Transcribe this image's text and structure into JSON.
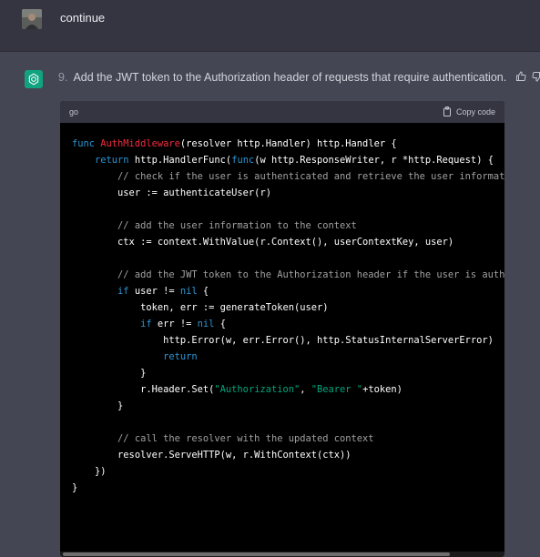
{
  "user_message": {
    "text": "continue"
  },
  "assistant_message": {
    "number": "9.",
    "text": "Add the JWT token to the Authorization header of requests that require authentication."
  },
  "code": {
    "language": "go",
    "copy_label": "Copy code",
    "lines": [
      [
        [
          "kw",
          "func "
        ],
        [
          "fn",
          "AuthMiddleware"
        ],
        [
          "",
          "(resolver http.Handler) http.Handler {"
        ]
      ],
      [
        [
          "",
          "    "
        ],
        [
          "kw",
          "return "
        ],
        [
          "",
          "http.HandlerFunc("
        ],
        [
          "kw",
          "func"
        ],
        [
          "",
          "(w http.ResponseWriter, r *http.Request) {"
        ]
      ],
      [
        [
          "",
          "        "
        ],
        [
          "cm",
          "// check if the user is authenticated and retrieve the user information"
        ]
      ],
      [
        [
          "",
          "        user := authenticateUser(r)"
        ]
      ],
      [
        [
          "",
          ""
        ]
      ],
      [
        [
          "",
          "        "
        ],
        [
          "cm",
          "// add the user information to the context"
        ]
      ],
      [
        [
          "",
          "        ctx := context.WithValue(r.Context(), userContextKey, user)"
        ]
      ],
      [
        [
          "",
          ""
        ]
      ],
      [
        [
          "",
          "        "
        ],
        [
          "cm",
          "// add the JWT token to the Authorization header if the user is authenticated"
        ]
      ],
      [
        [
          "",
          "        "
        ],
        [
          "kw",
          "if "
        ],
        [
          "",
          "user != "
        ],
        [
          "kw",
          "nil"
        ],
        [
          "",
          " {"
        ]
      ],
      [
        [
          "",
          "            token, err := generateToken(user)"
        ]
      ],
      [
        [
          "",
          "            "
        ],
        [
          "kw",
          "if "
        ],
        [
          "",
          "err != "
        ],
        [
          "kw",
          "nil"
        ],
        [
          "",
          " {"
        ]
      ],
      [
        [
          "",
          "                http.Error(w, err.Error(), http.StatusInternalServerError)"
        ]
      ],
      [
        [
          "",
          "                "
        ],
        [
          "kw",
          "return"
        ]
      ],
      [
        [
          "",
          "            }"
        ]
      ],
      [
        [
          "",
          "            r.Header.Set("
        ],
        [
          "st",
          "\"Authorization\""
        ],
        [
          "",
          ", "
        ],
        [
          "st",
          "\"Bearer \""
        ],
        [
          "",
          "+token)"
        ]
      ],
      [
        [
          "",
          "        }"
        ]
      ],
      [
        [
          "",
          ""
        ]
      ],
      [
        [
          "",
          "        "
        ],
        [
          "cm",
          "// call the resolver with the updated context"
        ]
      ],
      [
        [
          "",
          "        resolver.ServeHTTP(w, r.WithContext(ctx))"
        ]
      ],
      [
        [
          "",
          "    })"
        ]
      ],
      [
        [
          "",
          "}"
        ]
      ]
    ]
  },
  "colors": {
    "assistant_avatar": "#10a37f",
    "code_bg": "#000000",
    "page_bg": "#444654",
    "user_row_bg": "#343541"
  },
  "icons": {
    "assistant": "openai-logo-icon",
    "copy": "clipboard-icon",
    "like": "thumbs-up-icon",
    "dislike": "thumbs-down-icon"
  }
}
